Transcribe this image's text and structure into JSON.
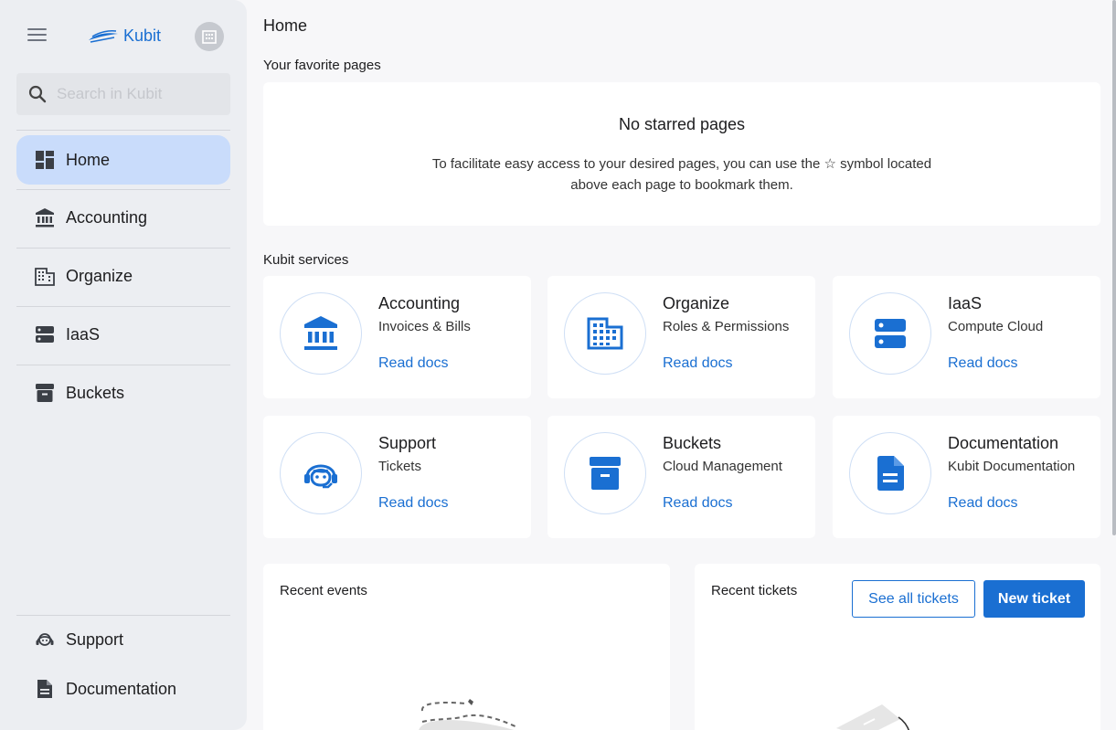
{
  "app": {
    "name": "Kubit"
  },
  "sidebar": {
    "search_placeholder": "Search in Kubit",
    "items": [
      {
        "label": "Home",
        "icon": "dashboard-icon",
        "active": true
      },
      {
        "label": "Accounting",
        "icon": "bank-icon"
      },
      {
        "label": "Organize",
        "icon": "building-icon"
      },
      {
        "label": "IaaS",
        "icon": "server-icon"
      },
      {
        "label": "Buckets",
        "icon": "archive-box-icon"
      }
    ],
    "footer_items": [
      {
        "label": "Support",
        "icon": "support-agent-icon"
      },
      {
        "label": "Documentation",
        "icon": "document-icon"
      }
    ]
  },
  "main": {
    "title": "Home",
    "favorites": {
      "heading": "Your favorite pages",
      "empty_title": "No starred pages",
      "empty_desc": "To facilitate easy access to your desired pages, you can use the ☆ symbol located above each page to bookmark them."
    },
    "services": {
      "heading": "Kubit services",
      "items": [
        {
          "name": "Accounting",
          "sub": "Invoices & Bills",
          "link": "Read docs",
          "icon": "bank-icon"
        },
        {
          "name": "Organize",
          "sub": "Roles & Permissions",
          "link": "Read docs",
          "icon": "building-icon"
        },
        {
          "name": "IaaS",
          "sub": "Compute Cloud",
          "link": "Read docs",
          "icon": "server-icon"
        },
        {
          "name": "Support",
          "sub": "Tickets",
          "link": "Read docs",
          "icon": "support-agent-icon"
        },
        {
          "name": "Buckets",
          "sub": "Cloud Management",
          "link": "Read docs",
          "icon": "archive-box-icon"
        },
        {
          "name": "Documentation",
          "sub": "Kubit Documentation",
          "link": "Read docs",
          "icon": "document-icon"
        }
      ]
    },
    "recent_events": {
      "title": "Recent events"
    },
    "recent_tickets": {
      "title": "Recent tickets",
      "see_all": "See all tickets",
      "new_ticket": "New ticket"
    }
  },
  "colors": {
    "accent": "#1a6fd2",
    "active_nav": "#c9dcfb",
    "sidebar_bg": "#eceef2"
  }
}
